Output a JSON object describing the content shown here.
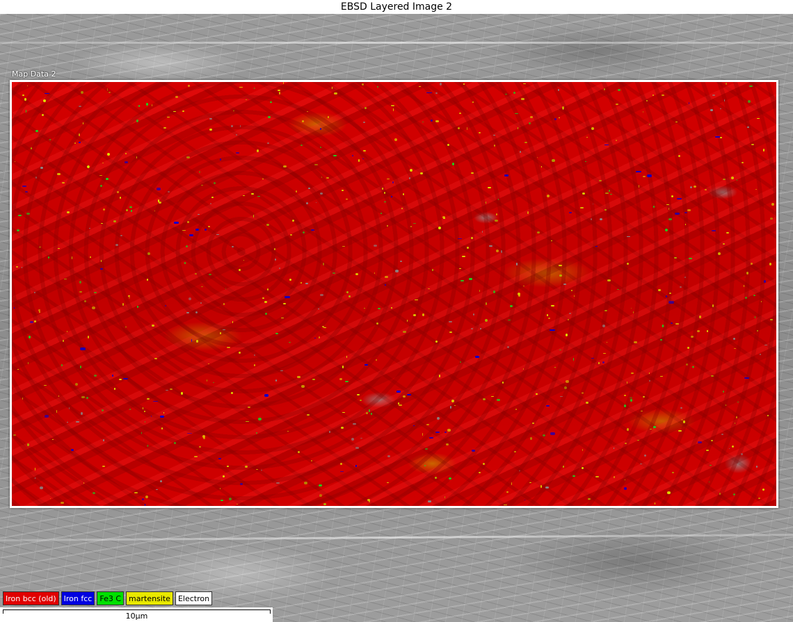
{
  "title": "EBSD Layered Image 2",
  "map_label": "Map Data 2",
  "legend": [
    {
      "label": "Iron bcc (old)",
      "bg": "#e00000",
      "fg": "#ffffff"
    },
    {
      "label": "Iron fcc",
      "bg": "#0000e0",
      "fg": "#ffffff"
    },
    {
      "label": "Fe3 C",
      "bg": "#00e000",
      "fg": "#000000"
    },
    {
      "label": "martensite",
      "bg": "#e8e800",
      "fg": "#000000"
    },
    {
      "label": "Electron",
      "bg": "#ffffff",
      "fg": "#000000"
    }
  ],
  "scale_bar": {
    "label": "10µm"
  }
}
